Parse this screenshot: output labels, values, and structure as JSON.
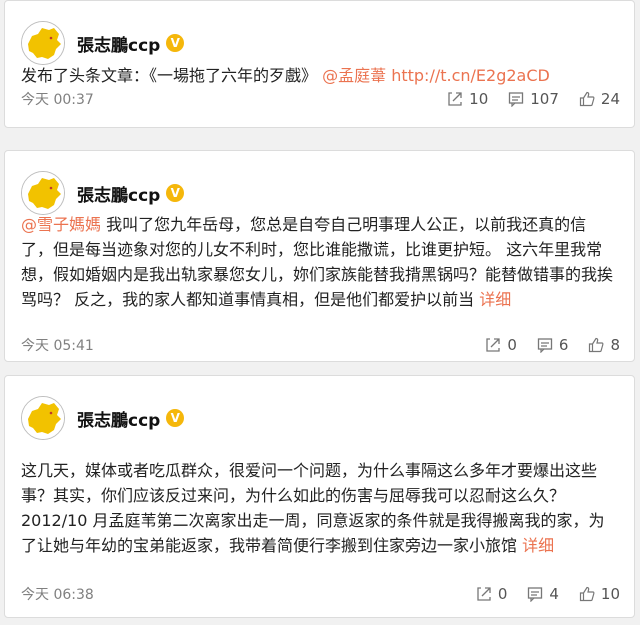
{
  "posts": [
    {
      "author": "張志鵬ccp",
      "badge": "V",
      "text_parts": {
        "prefix": "发布了头条文章：《一場拖了六年的歹戲》 ",
        "mention": "@孟庭葦",
        "sep": " ",
        "url": "http://t.cn/E2g2aCD"
      },
      "time": "今天 00:37",
      "reposts": "10",
      "comments": "107",
      "likes": "24"
    },
    {
      "author": "張志鵬ccp",
      "badge": "V",
      "text_parts": {
        "mention": "@雪子媽媽",
        "body": " 我叫了您九年岳母，您总是自夸自己明事理人公正，以前我还真的信了，但是每当迹象对您的儿女不利时，您比谁能撒谎，比谁更护短。 这六年里我常想，假如婚姻内是我出轨家暴您女儿，妳们家族能替我揹黑锅吗？能替做错事的我挨骂吗？ 反之，我的家人都知道事情真相，但是他们都爱护以前当 ",
        "more": "详细"
      },
      "time": "今天 05:41",
      "reposts": "0",
      "comments": "6",
      "likes": "8"
    },
    {
      "author": "張志鵬ccp",
      "badge": "V",
      "text_parts": {
        "body": "这几天，媒体或者吃瓜群众，很爱问一个问题，为什么事隔这么多年才要爆出这些事？其实，你们应该反过来问，为什么如此的伤害与屈辱我可以忍耐这么久？2012/10 月孟庭苇第二次离家出走一周，同意返家的条件就是我得搬离我的家，为了让她与年幼的宝弟能返家，我带着简便行李搬到住家旁边一家小旅馆 ",
        "more": "详细"
      },
      "time": "今天 06:38",
      "reposts": "0",
      "comments": "4",
      "likes": "10"
    }
  ],
  "icons": {
    "avatar": "china-map-avatar",
    "badge": "vip-badge",
    "repost": "repost-icon",
    "comment": "comment-icon",
    "like": "thumbs-up-icon"
  },
  "colors": {
    "link": "#eb7350",
    "badge": "#f5b70b",
    "map": "#f2c200"
  }
}
